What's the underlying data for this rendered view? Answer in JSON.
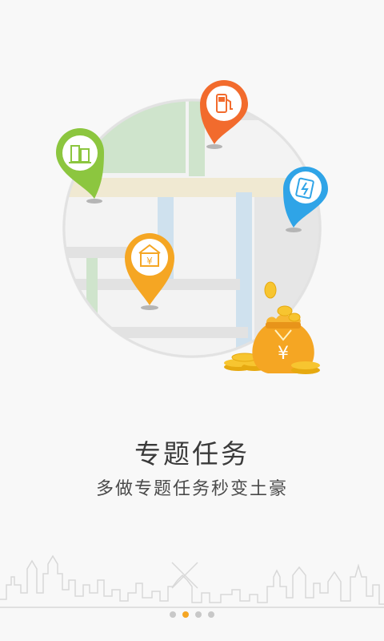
{
  "intro": {
    "title": "专题任务",
    "subtitle": "多做专题任务秒变土豪"
  },
  "pager": {
    "total": 4,
    "active_index": 1
  },
  "colors": {
    "pin_green": "#8cc63f",
    "pin_orange_red": "#f26b2d",
    "pin_blue": "#2fa4e7",
    "pin_orange": "#f5a623",
    "money_bag": "#f5a623",
    "active_dot": "#f5a623"
  }
}
